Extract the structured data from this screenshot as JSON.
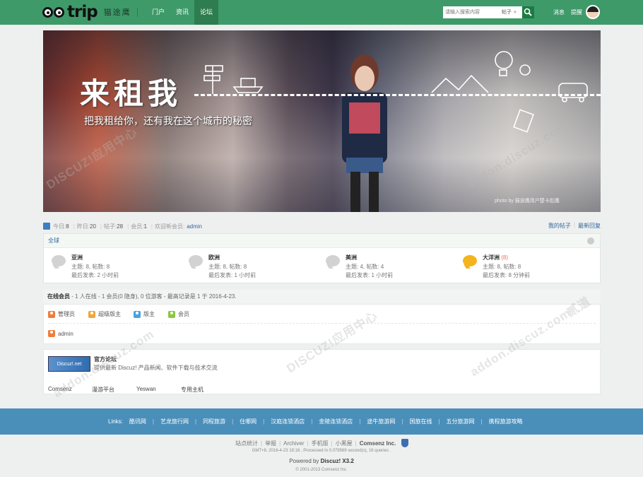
{
  "header": {
    "logo_word": "trip",
    "logo_cn": "猫途鹰",
    "nav": [
      "门户",
      "资讯",
      "论坛"
    ],
    "active_nav": "论坛",
    "search_placeholder": "请输入搜索内容",
    "search_type": "帖子",
    "user_links": [
      "消息",
      "提醒"
    ]
  },
  "banner": {
    "title": "来租我",
    "subtitle": "把我租给你，还有我在这个城市的秘密",
    "credit": "photo by 猫途鹰用户楚卡彪鹰"
  },
  "stats": {
    "today_label": "今日:",
    "today": "8",
    "yesterday_label": "昨日:",
    "yesterday": "20",
    "posts_label": "帖子:",
    "posts": "28",
    "members_label": "会员:",
    "members": "1",
    "welcome_label": "欢迎新会员:",
    "new_member": "admin",
    "my_posts": "我的帖子",
    "latest_replies": "最新回复"
  },
  "forum": {
    "category": "全球",
    "boards": [
      {
        "name": "亚洲",
        "new": "",
        "stats": "主题: 8, 帖数: 8",
        "last": "最后发表: 2 小时前"
      },
      {
        "name": "欧洲",
        "new": "",
        "stats": "主题: 8, 帖数: 8",
        "last": "最后发表: 1 小时前"
      },
      {
        "name": "美洲",
        "new": "",
        "stats": "主题: 4, 帖数: 4",
        "last": "最后发表: 1 小时前"
      },
      {
        "name": "大洋洲",
        "new": "(8)",
        "stats": "主题: 8, 帖数: 8",
        "last": "最后发表: 8 分钟前"
      }
    ]
  },
  "online": {
    "title": "在线会员",
    "summary": " - 1 人在线 - 1 会员(0 隐身), 0 位游客 - 最高记录是 1 于 2016-4-23.",
    "legend": [
      "管理员",
      "超级版主",
      "版主",
      "会员"
    ],
    "legend_colors": [
      "#f07d3c",
      "#f0a53c",
      "#4aa3df",
      "#8cc63f"
    ],
    "users": [
      "admin"
    ]
  },
  "links": {
    "logo_text": "Discuz!.net",
    "official_name": "官方论坛",
    "official_desc": "提供最新 Discuz! 产品新闻、软件下载与技术交流",
    "text_links": [
      "Comsenz",
      "漫游平台",
      "Yeswan",
      "专用主机"
    ]
  },
  "watermark": {
    "brand": "DISCUZ!应用中心",
    "url": "addon.discuz.com",
    "tag": "贰道"
  },
  "footer_links": {
    "label": "Links:",
    "items": [
      "酷讯网",
      "艺龙旅行网",
      "同程旅游",
      "住哪网",
      "汉庭连锁酒店",
      "金陵连锁酒店",
      "途牛旅游网",
      "国旅在线",
      "五分旅游网",
      "携程旅游攻略"
    ]
  },
  "footer": {
    "links": [
      "站点统计",
      "举报",
      "Archiver",
      "手机版",
      "小黑屋"
    ],
    "company": "Comsenz Inc.",
    "time_line": "GMT+8, 2016-4-23 19:18 , Processed in 0.079569 second(s), 16 queries .",
    "powered_prefix": "Powered by ",
    "powered_name": "Discuz! X3.2",
    "copyright": "© 2001-2013 Comsenz Inc."
  }
}
